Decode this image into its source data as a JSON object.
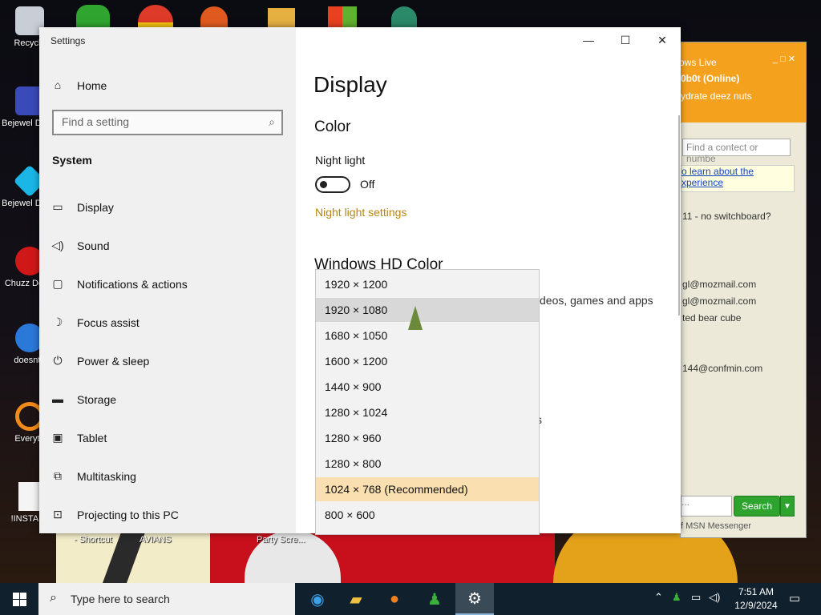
{
  "desktop": {
    "icons": [
      {
        "label": "Recycle"
      },
      {
        "label": "Bejewel Delux"
      },
      {
        "label": "Bejewel Delux"
      },
      {
        "label": "Chuzz Delux"
      },
      {
        "label": "doesnt t"
      },
      {
        "label": "Everyth"
      },
      {
        "label": "!INSTALL"
      }
    ],
    "bottom_labels": [
      "- Shortcut",
      "AVIANS",
      "Party Scre..."
    ]
  },
  "settings": {
    "window_title": "Settings",
    "home_label": "Home",
    "search_placeholder": "Find a setting",
    "section_label": "System",
    "nav_items": [
      {
        "label": "Display",
        "icon": "monitor-icon"
      },
      {
        "label": "Sound",
        "icon": "speaker-icon"
      },
      {
        "label": "Notifications & actions",
        "icon": "notification-icon"
      },
      {
        "label": "Focus assist",
        "icon": "moon-icon"
      },
      {
        "label": "Power & sleep",
        "icon": "power-icon"
      },
      {
        "label": "Storage",
        "icon": "storage-icon"
      },
      {
        "label": "Tablet",
        "icon": "tablet-icon"
      },
      {
        "label": "Multitasking",
        "icon": "multitasking-icon"
      },
      {
        "label": "Projecting to this PC",
        "icon": "projecting-icon"
      }
    ],
    "page_title": "Display",
    "color_heading": "Color",
    "night_light_label": "Night light",
    "night_light_state": "Off",
    "night_light_link": "Night light settings",
    "hdr_heading": "Windows HD Color",
    "hdr_description": "deos, games and apps",
    "partial_text": "s"
  },
  "resolution_dropdown": {
    "options": [
      "1920 × 1200",
      "1920 × 1080",
      "1680 × 1050",
      "1600 × 1200",
      "1440 × 900",
      "1280 × 1024",
      "1280 × 960",
      "1280 × 800",
      "1024 × 768 (Recommended)",
      "800 × 600"
    ],
    "hovered": "1920 × 1080",
    "selected": "1024 × 768 (Recommended)"
  },
  "msn": {
    "header_title": "ows Live",
    "user": "0b0t (Online)",
    "status_msg": "ydrate deez nuts",
    "find_placeholder": "Find a contect or numbe",
    "tip_line1": "o learn about the",
    "tip_line2": "xperience",
    "contacts": [
      "11 - no switchboard?",
      "gl@mozmail.com",
      "gl@mozmail.com",
      "ted bear cube",
      "144@confmin.com"
    ],
    "search_button": "Search",
    "input_value": "...",
    "footer": "f MSN Messenger"
  },
  "taskbar": {
    "search_placeholder": "Type here to search",
    "time": "7:51 AM",
    "date": "12/9/2024"
  }
}
